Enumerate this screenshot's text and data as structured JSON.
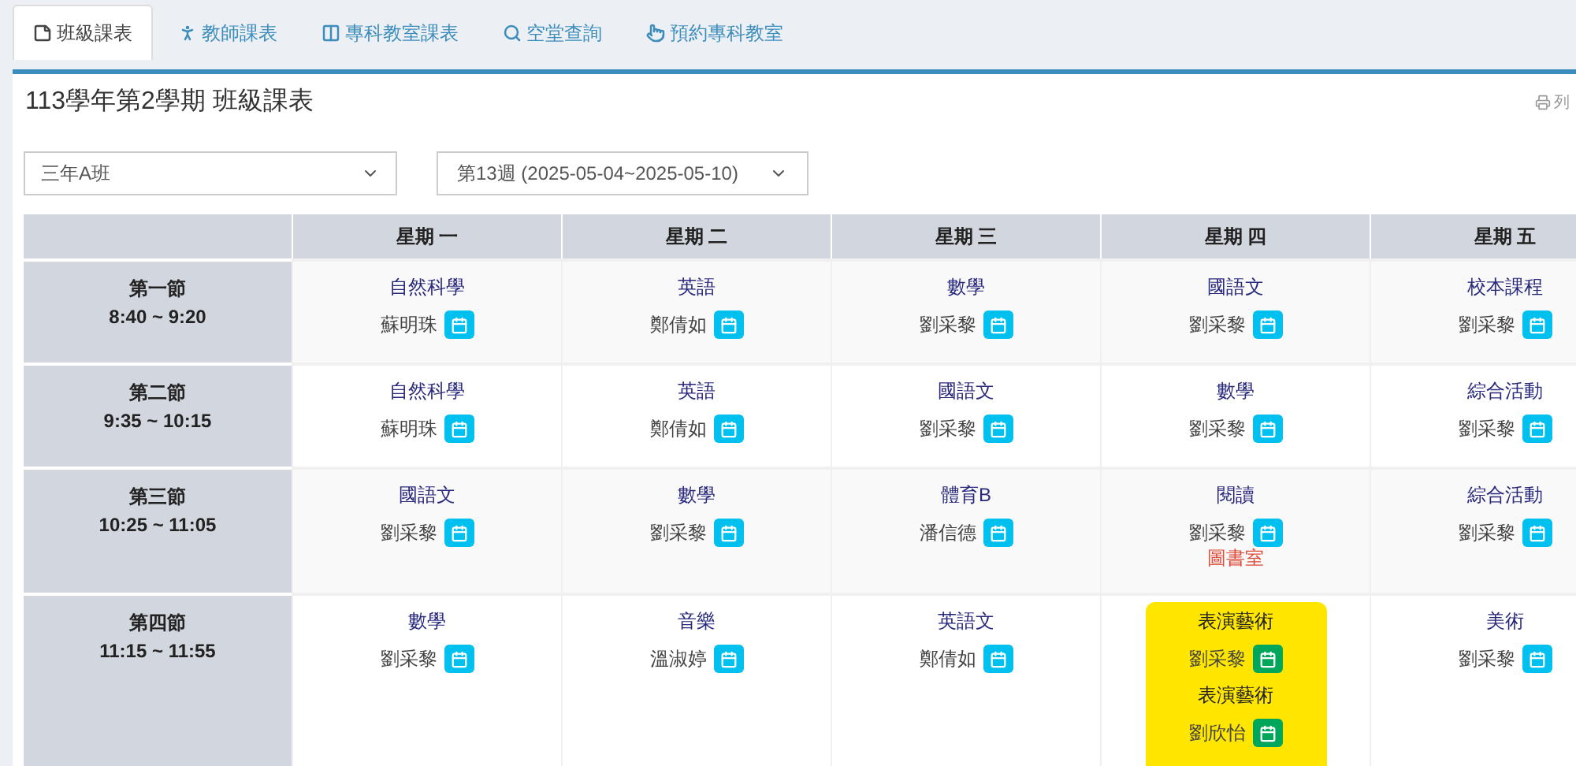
{
  "tabs": [
    {
      "label": "班級課表",
      "selected": true,
      "kind": "note"
    },
    {
      "label": "教師課表",
      "selected": false,
      "kind": "person"
    },
    {
      "label": "專科教室課表",
      "selected": false,
      "kind": "columns"
    },
    {
      "label": "空堂查詢",
      "selected": false,
      "kind": "search"
    },
    {
      "label": "預約專科教室",
      "selected": false,
      "kind": "pointer"
    }
  ],
  "title": "113學年第2學期 班級課表",
  "print_link": "列",
  "class_select": {
    "value": "三年A班"
  },
  "week_select": {
    "value": "第13週 (2025-05-04~2025-05-10)"
  },
  "table": {
    "days": [
      "星期 一",
      "星期 二",
      "星期 三",
      "星期 四",
      "星期 五"
    ],
    "rows": [
      {
        "period": "第一節",
        "time": "8:40 ~ 9:20",
        "cells": [
          {
            "highlighted": false,
            "lessons": [
              {
                "subject": "自然科學",
                "teacher": "蘇明珠",
                "color": "#00c0ef"
              }
            ]
          },
          {
            "highlighted": false,
            "lessons": [
              {
                "subject": "英語",
                "teacher": "鄭倩如",
                "color": "#00c0ef"
              }
            ]
          },
          {
            "highlighted": false,
            "lessons": [
              {
                "subject": "數學",
                "teacher": "劉采黎",
                "color": "#00c0ef"
              }
            ]
          },
          {
            "highlighted": false,
            "lessons": [
              {
                "subject": "國語文",
                "teacher": "劉采黎",
                "color": "#00c0ef"
              }
            ]
          },
          {
            "highlighted": false,
            "lessons": [
              {
                "subject": "校本課程",
                "teacher": "劉采黎",
                "color": "#00c0ef"
              }
            ]
          }
        ]
      },
      {
        "period": "第二節",
        "time": "9:35 ~ 10:15",
        "cells": [
          {
            "highlighted": false,
            "lessons": [
              {
                "subject": "自然科學",
                "teacher": "蘇明珠",
                "color": "#00c0ef"
              }
            ]
          },
          {
            "highlighted": false,
            "lessons": [
              {
                "subject": "英語",
                "teacher": "鄭倩如",
                "color": "#00c0ef"
              }
            ]
          },
          {
            "highlighted": false,
            "lessons": [
              {
                "subject": "國語文",
                "teacher": "劉采黎",
                "color": "#00c0ef"
              }
            ]
          },
          {
            "highlighted": false,
            "lessons": [
              {
                "subject": "數學",
                "teacher": "劉采黎",
                "color": "#00c0ef"
              }
            ]
          },
          {
            "highlighted": false,
            "lessons": [
              {
                "subject": "綜合活動",
                "teacher": "劉采黎",
                "color": "#00c0ef"
              }
            ]
          }
        ]
      },
      {
        "period": "第三節",
        "time": "10:25 ~ 11:05",
        "cells": [
          {
            "highlighted": false,
            "lessons": [
              {
                "subject": "國語文",
                "teacher": "劉采黎",
                "color": "#00c0ef"
              }
            ]
          },
          {
            "highlighted": false,
            "lessons": [
              {
                "subject": "數學",
                "teacher": "劉采黎",
                "color": "#00c0ef"
              }
            ]
          },
          {
            "highlighted": false,
            "lessons": [
              {
                "subject": "體育B",
                "teacher": "潘信德",
                "color": "#00c0ef"
              }
            ]
          },
          {
            "highlighted": false,
            "lessons": [
              {
                "subject": "閱讀",
                "teacher": "劉采黎",
                "color": "#00c0ef",
                "room": "圖書室"
              }
            ]
          },
          {
            "highlighted": false,
            "lessons": [
              {
                "subject": "綜合活動",
                "teacher": "劉采黎",
                "color": "#00c0ef"
              }
            ]
          }
        ]
      },
      {
        "period": "第四節",
        "time": "11:15 ~ 11:55",
        "cells": [
          {
            "highlighted": false,
            "lessons": [
              {
                "subject": "數學",
                "teacher": "劉采黎",
                "color": "#00c0ef"
              }
            ]
          },
          {
            "highlighted": false,
            "lessons": [
              {
                "subject": "音樂",
                "teacher": "溫淑婷",
                "color": "#00c0ef"
              }
            ]
          },
          {
            "highlighted": false,
            "lessons": [
              {
                "subject": "英語文",
                "teacher": "鄭倩如",
                "color": "#00c0ef"
              }
            ]
          },
          {
            "highlighted": true,
            "lessons": [
              {
                "subject": "表演藝術",
                "teacher": "劉采黎",
                "color": "#00a65a"
              },
              {
                "subject": "表演藝術",
                "teacher": "劉欣怡",
                "color": "#00a65a"
              }
            ]
          },
          {
            "highlighted": false,
            "lessons": [
              {
                "subject": "美術",
                "teacher": "劉采黎",
                "color": "#00c0ef"
              }
            ]
          }
        ]
      }
    ]
  }
}
